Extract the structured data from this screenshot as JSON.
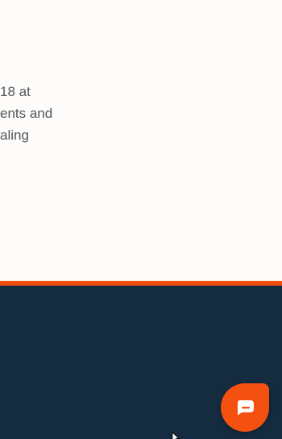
{
  "content": {
    "paragraph_lines": [
      "18 at",
      "ents and",
      "aling"
    ]
  },
  "footer": {
    "chat_button": {
      "icon": "chat-bubble-icon"
    }
  },
  "colors": {
    "page_background": "#fdfcfa",
    "accent": "#f04e0f",
    "footer_background": "#142b40",
    "chat_button": "#f4500f",
    "body_text": "#555555"
  }
}
